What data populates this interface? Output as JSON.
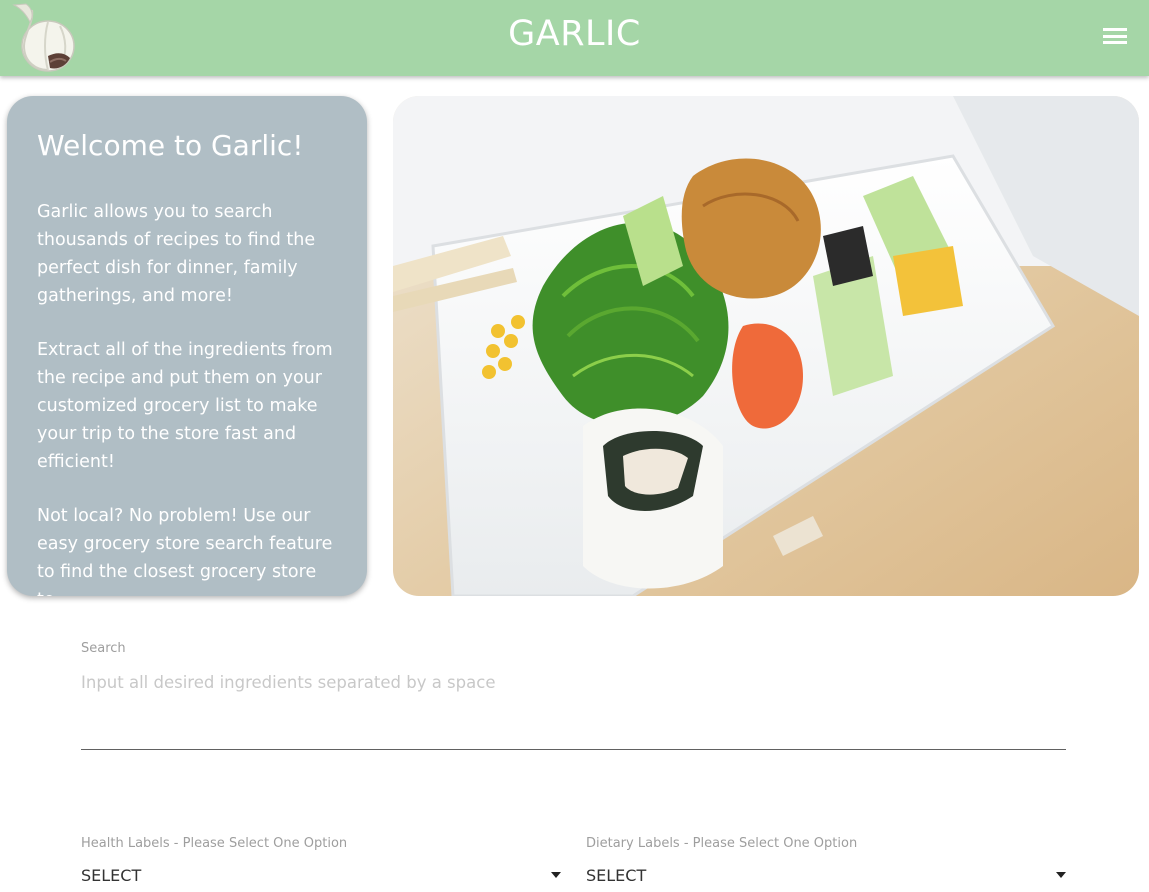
{
  "navbar": {
    "brand": "GARLIC",
    "logo_icon": "garlic-bulb-icon",
    "menu_icon": "hamburger-menu-icon",
    "background_color": "#a5d6a7"
  },
  "welcome": {
    "title": "Welcome to Garlic!",
    "paragraphs": [
      "Garlic allows you to search thousands of recipes to find the perfect dish for dinner, family gatherings, and more!",
      "Extract all of the ingredients from the recipe and put them on your customized grocery list to make your trip to the store fast and efficient!",
      "Not local? No problem! Use our easy grocery store search feature to find the closest grocery store to"
    ],
    "background_color": "#b0bec5"
  },
  "hero": {
    "image_description": "bento-box-food-image"
  },
  "search": {
    "label": "Search",
    "placeholder": "Input all desired ingredients separated by a space",
    "value": ""
  },
  "filters": {
    "health": {
      "label": "Health Labels - Please Select One Option",
      "selected": "SELECT"
    },
    "dietary": {
      "label": "Dietary Labels - Please Select One Option",
      "selected": "SELECT"
    }
  }
}
